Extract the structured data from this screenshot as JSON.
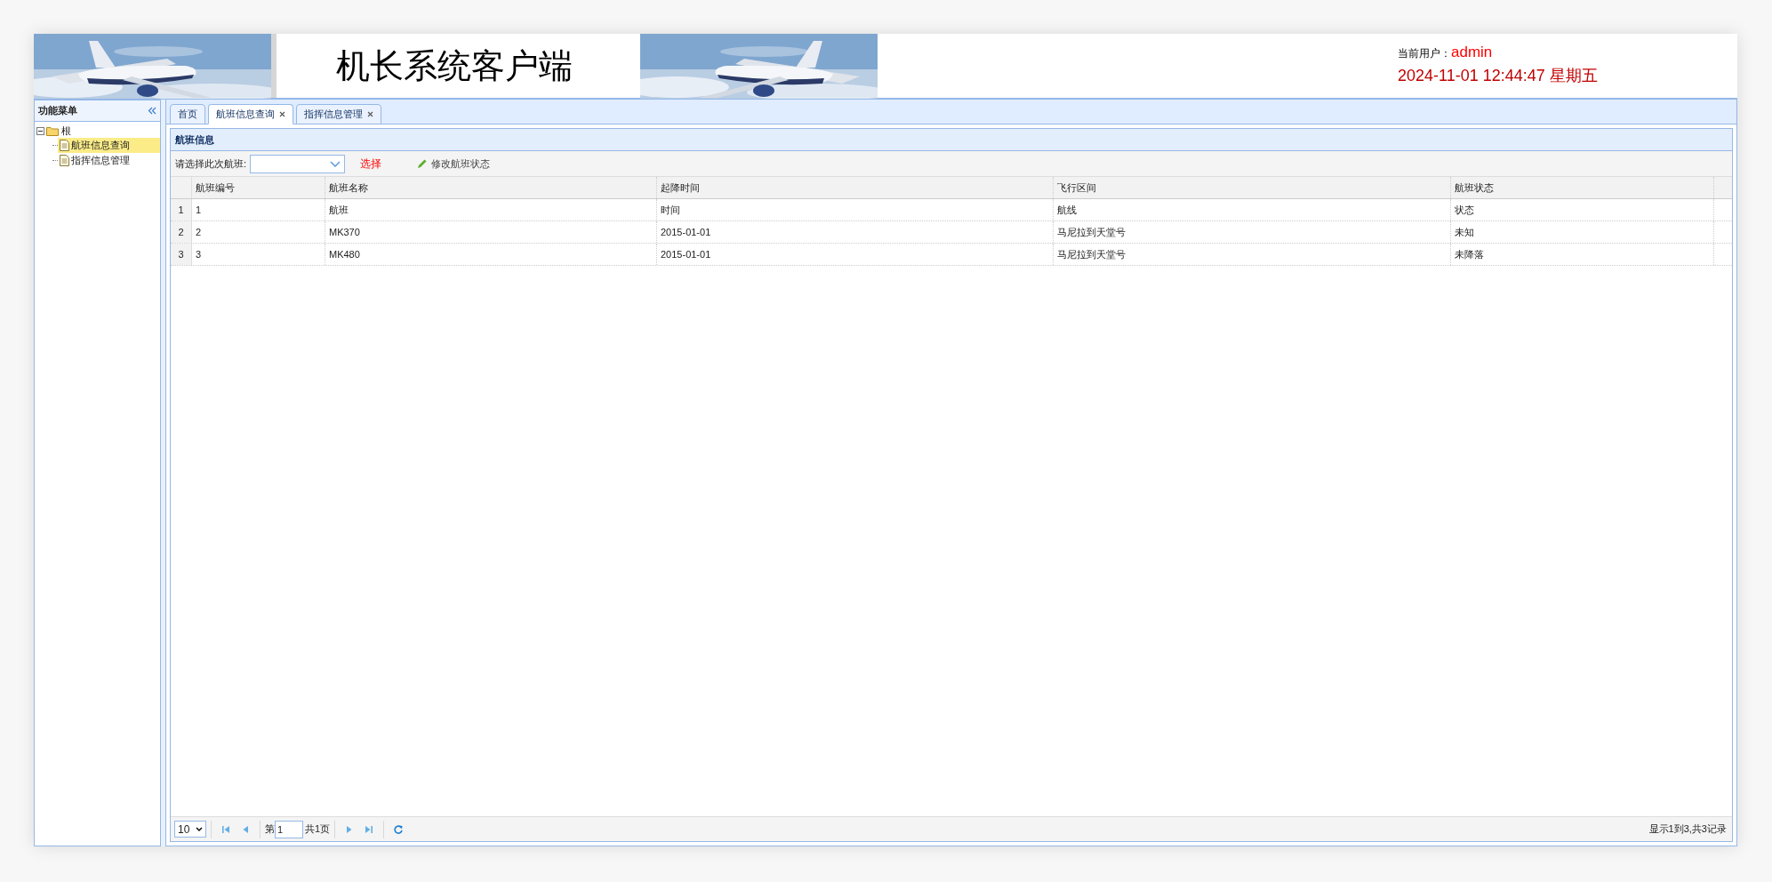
{
  "header": {
    "title": "机长系统客户端",
    "user_label": "当前用户：",
    "user": "admin",
    "datetime": "2024-11-01 12:44:47 星期五"
  },
  "sidebar": {
    "title": "功能菜单",
    "tree": [
      {
        "label": "根",
        "expanded": true,
        "children": [
          {
            "label": "航班信息查询",
            "selected": true
          },
          {
            "label": "指挥信息管理",
            "selected": false
          }
        ]
      }
    ]
  },
  "tabs": [
    {
      "label": "首页",
      "selected": false,
      "closable": false
    },
    {
      "label": "航班信息查询",
      "selected": true,
      "closable": true
    },
    {
      "label": "指挥信息管理",
      "selected": false,
      "closable": true
    }
  ],
  "panel": {
    "title": "航班信息",
    "filter_label": "请选择此次航班:",
    "select_button": "选择",
    "edit_button": "修改航班状态"
  },
  "table": {
    "columns": [
      "航班编号",
      "航班名称",
      "起降时间",
      "飞行区间",
      "航班状态"
    ],
    "rows": [
      {
        "number": "1",
        "cells": [
          "1",
          "航班",
          "时间",
          "航线",
          "状态"
        ]
      },
      {
        "number": "2",
        "cells": [
          "2",
          "MK370",
          "2015-01-01",
          "马尼拉到天堂号",
          "未知"
        ]
      },
      {
        "number": "3",
        "cells": [
          "3",
          "MK480",
          "2015-01-01",
          "马尼拉到天堂号",
          "未降落"
        ]
      }
    ]
  },
  "pager": {
    "page_size": "10",
    "page_prefix": "第",
    "page": "1",
    "page_suffix": "共1页",
    "summary": "显示1到3,共3记录"
  }
}
